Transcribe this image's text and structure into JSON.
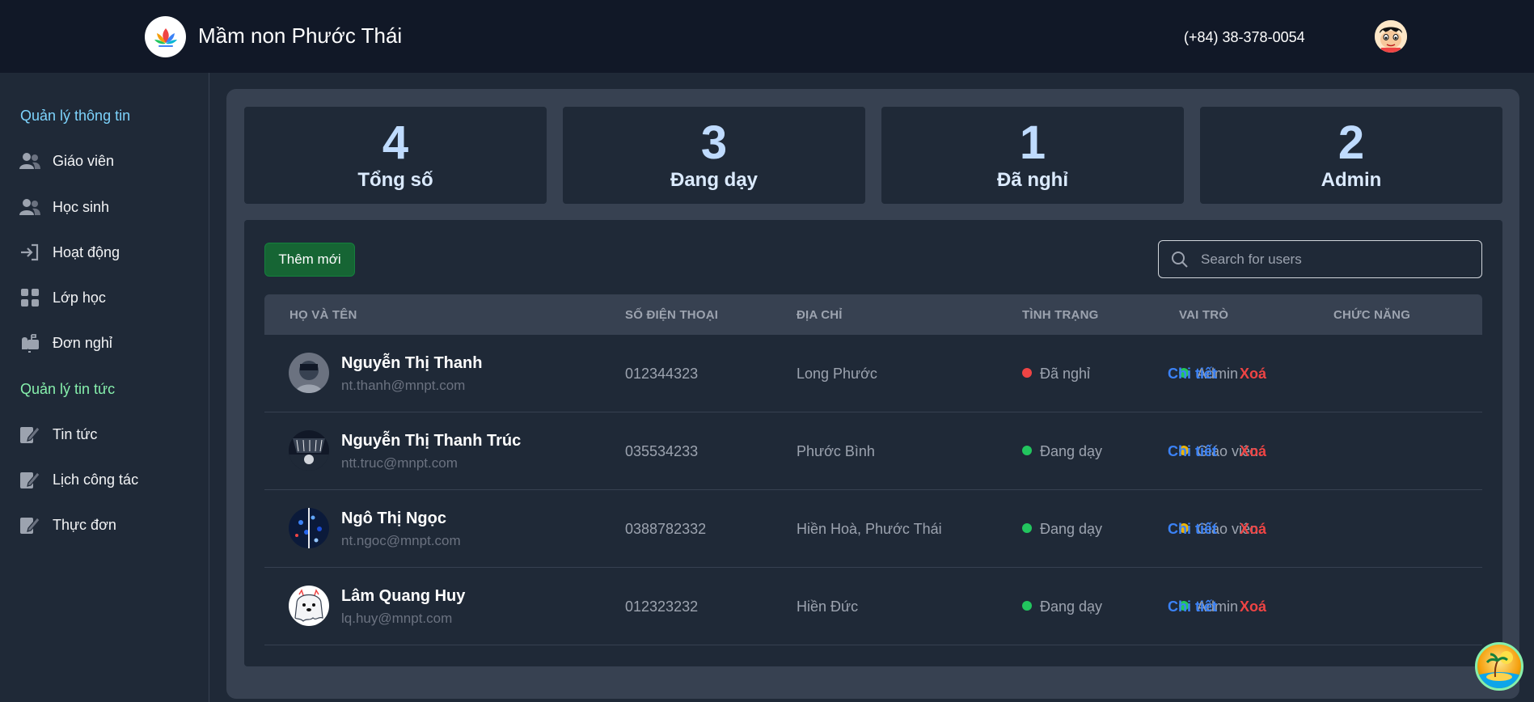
{
  "header": {
    "title": "Mầm non Phước Thái",
    "phone": "(+84) 38-378-0054",
    "colors": {
      "background": "#111827"
    }
  },
  "sidebar": {
    "sections": [
      {
        "heading": "Quản lý thông tin",
        "items": [
          {
            "label": "Giáo viên",
            "icon": "users-icon"
          },
          {
            "label": "Học sinh",
            "icon": "users-icon"
          },
          {
            "label": "Hoạt động",
            "icon": "sign-in-icon"
          },
          {
            "label": "Lớp học",
            "icon": "grid-icon"
          },
          {
            "label": "Đơn nghỉ",
            "icon": "mailbox-icon"
          }
        ]
      },
      {
        "heading": "Quản lý tin tức",
        "items": [
          {
            "label": "Tin tức",
            "icon": "edit-doc-icon"
          },
          {
            "label": "Lịch công tác",
            "icon": "edit-doc-icon"
          },
          {
            "label": "Thực đơn",
            "icon": "edit-doc-icon"
          }
        ]
      }
    ]
  },
  "stats": [
    {
      "value": "4",
      "label": "Tổng số"
    },
    {
      "value": "3",
      "label": "Đang dạy"
    },
    {
      "value": "1",
      "label": "Đã nghỉ"
    },
    {
      "value": "2",
      "label": "Admin"
    }
  ],
  "toolbar": {
    "add_label": "Thêm mới",
    "search_placeholder": "Search for users"
  },
  "table": {
    "headers": [
      "HỌ VÀ TÊN",
      "SỐ ĐIỆN THOẠI",
      "ĐỊA CHỈ",
      "TÌNH TRẠNG",
      "VAI TRÒ",
      "CHỨC NĂNG"
    ],
    "detail_label": "Chi tiết",
    "delete_label": "Xoá",
    "rows": [
      {
        "name": "Nguyễn Thị Thanh",
        "email": "nt.thanh@mnpt.com",
        "phone": "012344323",
        "address": "Long Phước",
        "status": "Đã nghỉ",
        "status_color": "#ef4444",
        "role": "Admin",
        "role_color": "#22c55e"
      },
      {
        "name": "Nguyễn Thị Thanh Trúc",
        "email": "ntt.truc@mnpt.com",
        "phone": "035534233",
        "address": "Phước Bình",
        "status": "Đang dạy",
        "status_color": "#22c55e",
        "role": "Giáo viên",
        "role_color": "#eab308"
      },
      {
        "name": "Ngô Thị Ngọc",
        "email": "nt.ngoc@mnpt.com",
        "phone": "0388782332",
        "address": "Hiền Hoà, Phước Thái",
        "status": "Đang dạy",
        "status_color": "#22c55e",
        "role": "Giáo viên",
        "role_color": "#eab308"
      },
      {
        "name": "Lâm Quang Huy",
        "email": "lq.huy@mnpt.com",
        "phone": "012323232",
        "address": "Hiền Đức",
        "status": "Đang dạy",
        "status_color": "#22c55e",
        "role": "Admin",
        "role_color": "#22c55e"
      }
    ]
  }
}
